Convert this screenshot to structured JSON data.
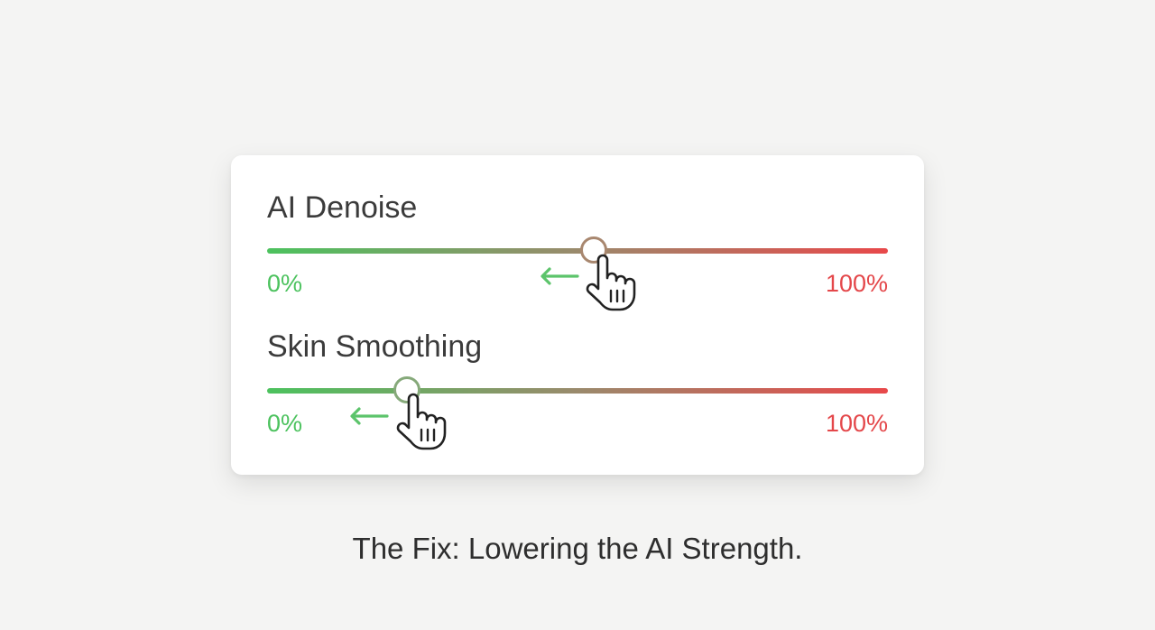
{
  "colors": {
    "background": "#f4f4f3",
    "card": "#ffffff",
    "min_color": "#4cc25e",
    "max_color": "#e4474a",
    "mid_color": "#9a8a6c"
  },
  "sliders": [
    {
      "label": "AI Denoise",
      "min_label": "0%",
      "max_label": "100%",
      "value_fraction": 0.53,
      "thumb_color": "#a8876f",
      "drag_direction": "left"
    },
    {
      "label": "Skin Smoothing",
      "min_label": "0%",
      "max_label": "100%",
      "value_fraction": 0.23,
      "thumb_color": "#86a97a",
      "drag_direction": "left"
    }
  ],
  "icons": {
    "drag": "left-arrow-icon",
    "cursor": "hand-pointer-icon"
  },
  "caption": "The Fix: Lowering the AI Strength."
}
